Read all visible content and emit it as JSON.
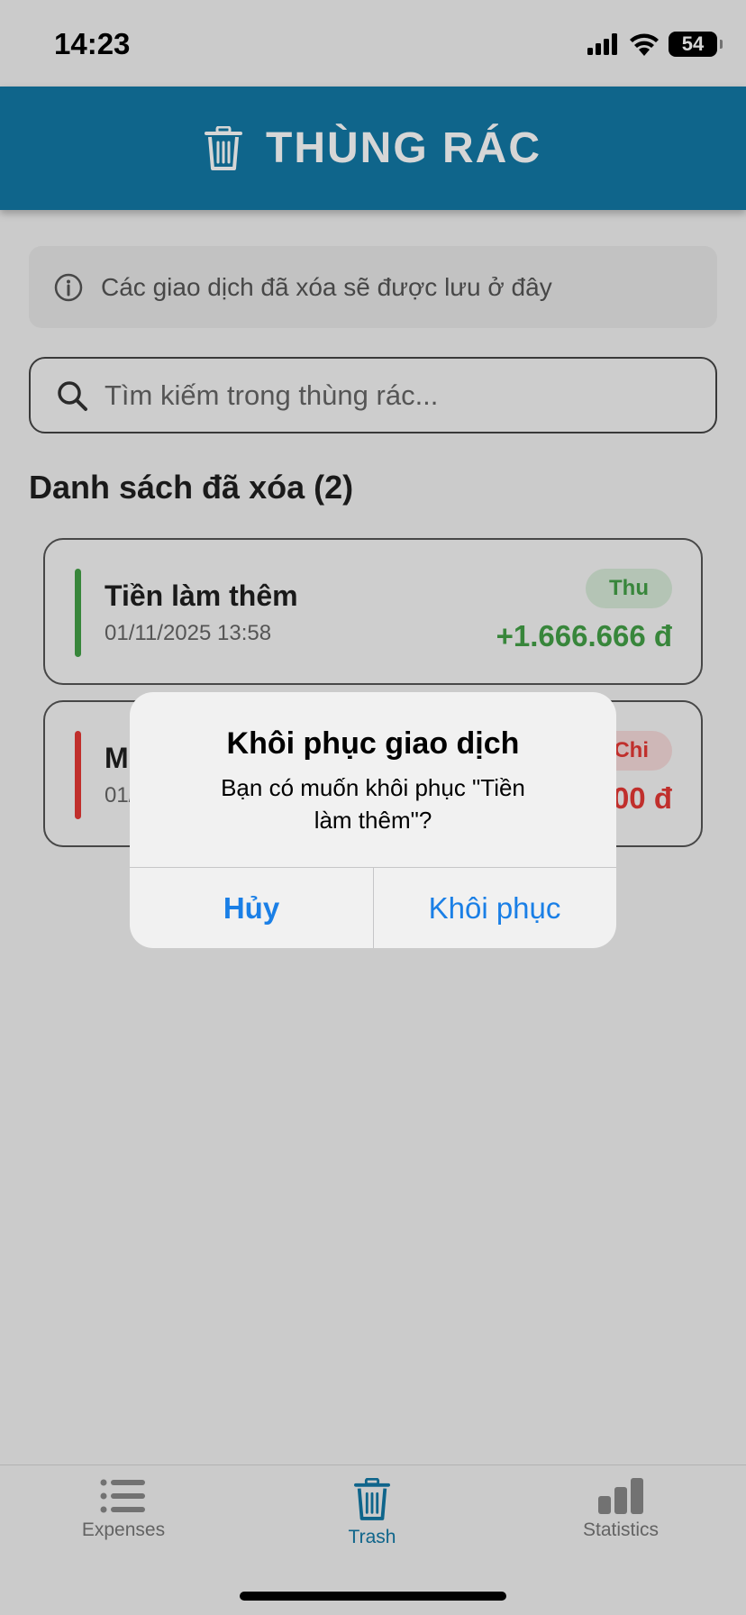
{
  "status_bar": {
    "time": "14:23",
    "battery": "54"
  },
  "header": {
    "title": "THÙNG RÁC",
    "icon": "trash-icon"
  },
  "info": {
    "text": "Các giao dịch đã xóa sẽ được lưu ở đây",
    "icon": "info-icon"
  },
  "search": {
    "placeholder": "Tìm kiếm trong thùng rác...",
    "icon": "search-icon"
  },
  "list": {
    "title": "Danh sách đã xóa (2)",
    "items": [
      {
        "title": "Tiền làm thêm",
        "date": "01/11/2025 13:58",
        "badge": "Thu",
        "amount": "+1.666.666 đ",
        "color": "#43a047"
      },
      {
        "title": "M",
        "date": "01/",
        "badge": "Chi",
        "amount": "00 đ",
        "color": "#e53935"
      }
    ]
  },
  "dialog": {
    "title": "Khôi phục giao dịch",
    "message": "Bạn có muốn khôi phục \"Tiền làm thêm\"?",
    "cancel": "Hủy",
    "confirm": "Khôi phục"
  },
  "tabbar": {
    "tabs": [
      {
        "label": "Expenses",
        "icon": "list-icon",
        "active": false
      },
      {
        "label": "Trash",
        "icon": "trash-icon",
        "active": true
      },
      {
        "label": "Statistics",
        "icon": "bar-chart-icon",
        "active": false
      }
    ]
  },
  "colors": {
    "accent": "#1279a6",
    "income": "#43a047",
    "expense": "#e53935",
    "dialog_button": "#1a7fe6"
  }
}
